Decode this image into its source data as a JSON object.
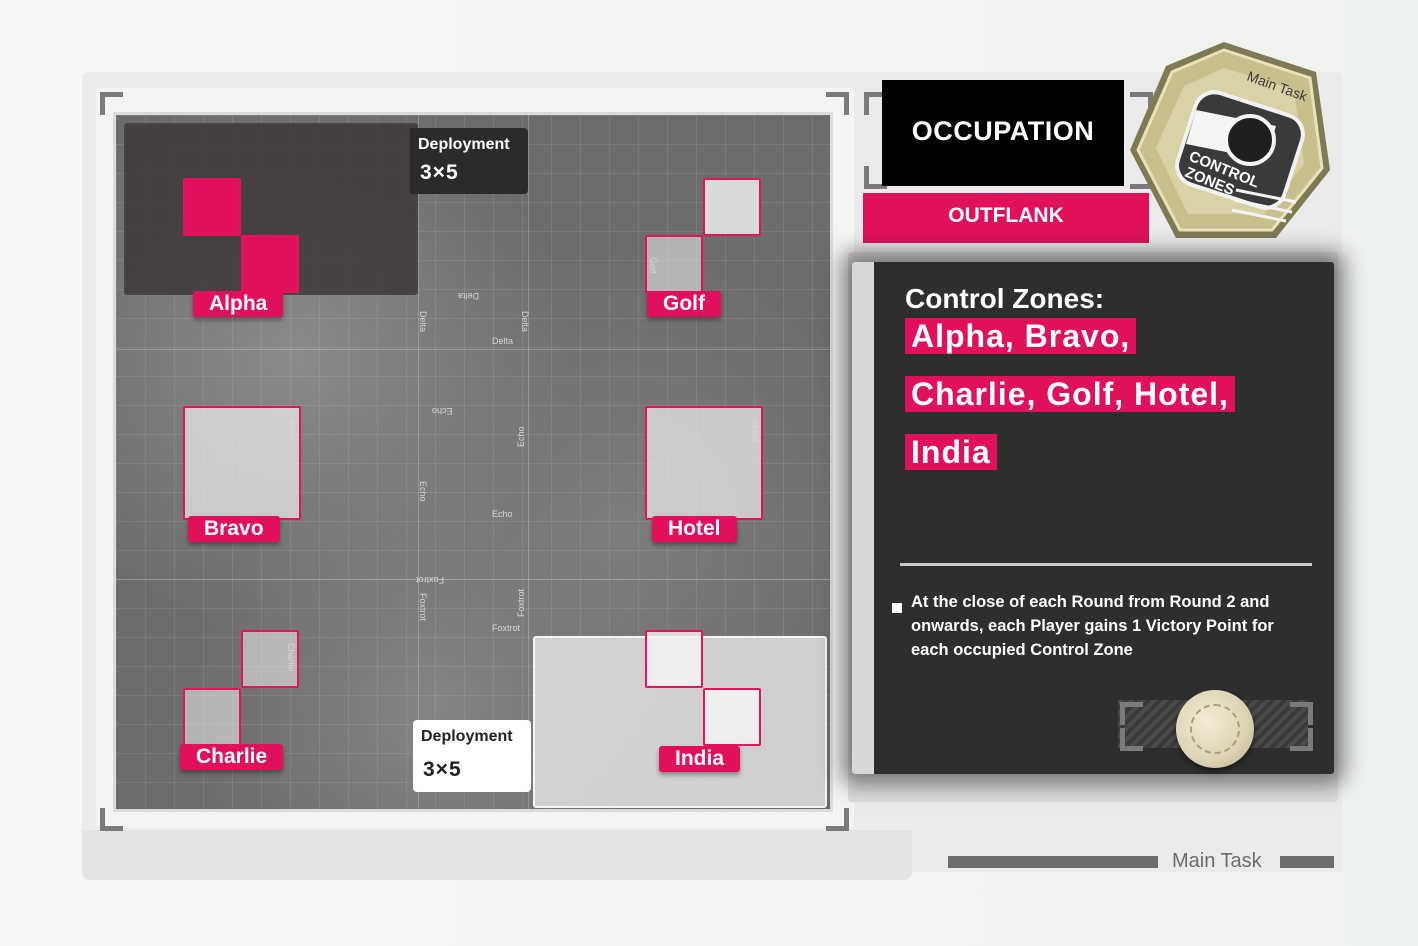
{
  "map": {
    "deployment_top": {
      "title": "Deployment",
      "size": "3×5"
    },
    "deployment_bottom": {
      "title": "Deployment",
      "size": "3×5"
    },
    "sector_labels": [
      "Delta",
      "Delta",
      "Delta",
      "Delta",
      "Echo",
      "Echo",
      "Echo",
      "Echo",
      "Foxtrot",
      "Foxtrot",
      "Foxtrot",
      "Foxtrot"
    ],
    "zones": {
      "alpha": "Alpha",
      "bravo": "Bravo",
      "charlie": "Charlie",
      "golf": "Golf",
      "hotel": "Hotel",
      "india": "India"
    },
    "zone_edge_labels": {
      "golf": "Golf",
      "bravo": "Bravo",
      "hotel": "Hotel",
      "charlie": "Charlie"
    }
  },
  "mission": {
    "title": "OCCUPATION",
    "variant": "OUTFLANK"
  },
  "badge": {
    "top_text": "Main Task",
    "center_text_1": "CONTROL",
    "center_text_2": "ZONES"
  },
  "panel": {
    "heading": "Control Zones:",
    "zone_lines": [
      "Alpha, Bravo,",
      "Charlie, Golf, Hotel,",
      "India"
    ],
    "rule": "At the close of each Round from Round 2 and onwards, each Player gains 1 Victory Point for each occupied Control Zone"
  },
  "footer": {
    "label": "Main Task"
  },
  "colors": {
    "accent": "#e0105c",
    "panel": "#2d2e2e",
    "title_box": "#000000"
  }
}
